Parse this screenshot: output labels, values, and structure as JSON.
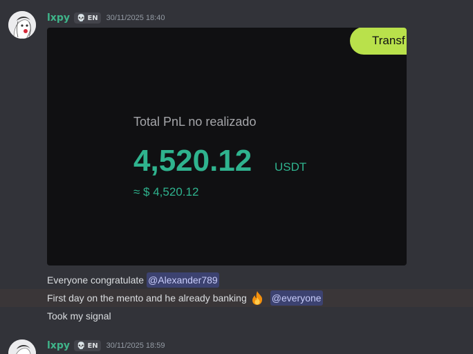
{
  "messages": [
    {
      "username": "lxpy",
      "tag": {
        "icon": "skull-icon",
        "label": "EN"
      },
      "timestamp": "30/11/2025 18:40",
      "card": {
        "button_label": "Transf",
        "pnl_label": "Total PnL no realizado",
        "pnl_value": "4,520.12",
        "pnl_unit": "USDT",
        "pnl_approx": "≈ $ 4,520.12"
      },
      "lines": [
        {
          "text": "Everyone congratulate",
          "mention": "@Alexander789"
        },
        {
          "text": "First day on the mento and he already banking",
          "emoji": "fire-icon",
          "mention": "@everyone"
        },
        {
          "text": "Took my signal"
        }
      ]
    },
    {
      "username": "lxpy",
      "tag": {
        "icon": "skull-icon",
        "label": "EN"
      },
      "timestamp": "30/11/2025 18:59"
    }
  ],
  "colors": {
    "background": "#323339",
    "username": "#3fb58a",
    "accent_green": "#2fb38e",
    "button_lime": "#b9e14b",
    "mention_bg": "#3c4270"
  }
}
